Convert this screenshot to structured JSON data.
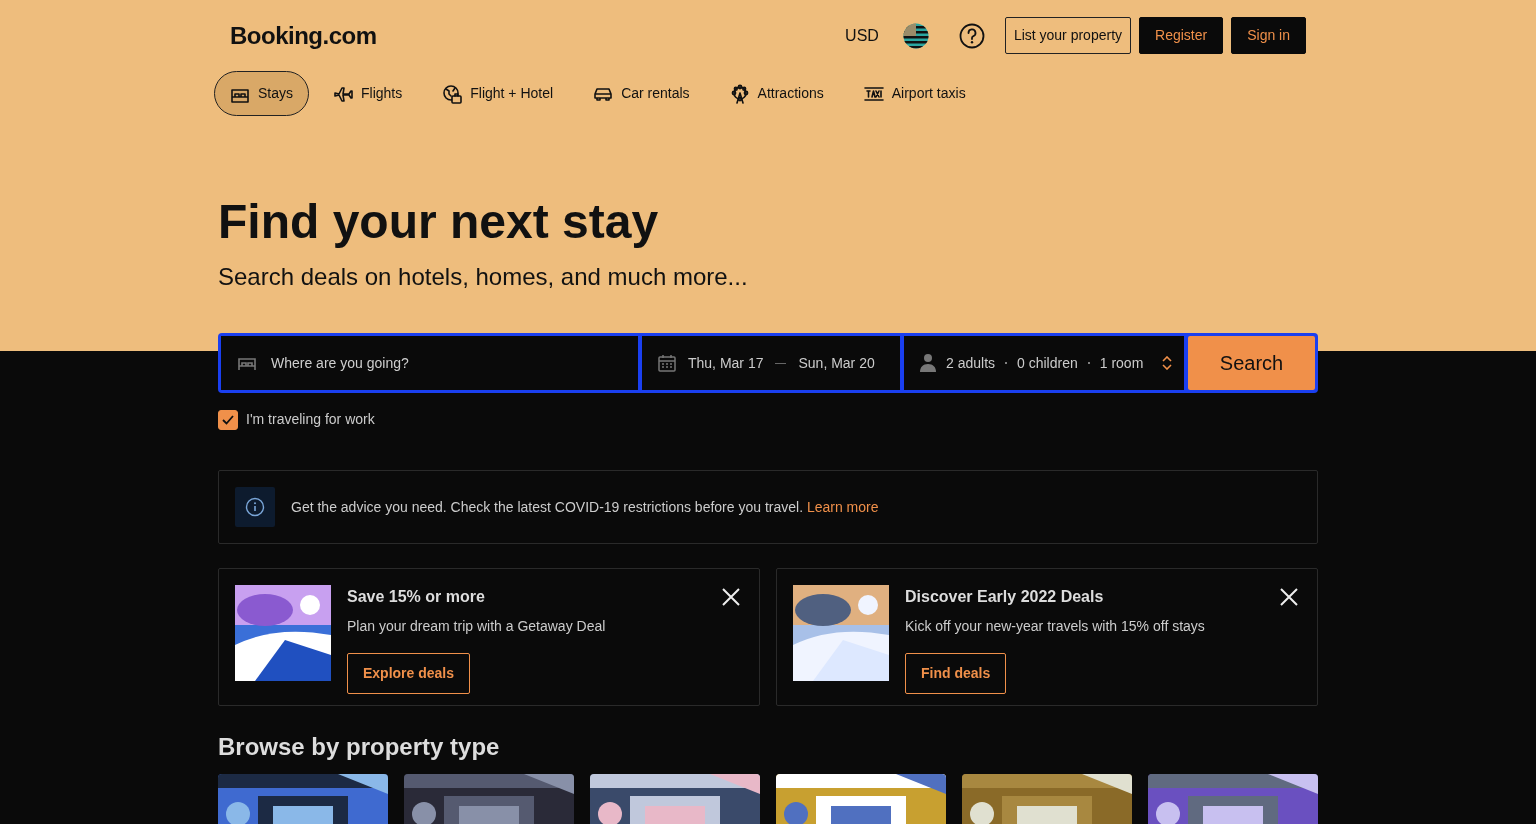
{
  "header": {
    "logo": "Booking.com",
    "currency": "USD",
    "buttons": [
      {
        "kind": "outline",
        "label": "List your property"
      },
      {
        "kind": "dark",
        "label": "Register"
      },
      {
        "kind": "dark",
        "label": "Sign in"
      }
    ]
  },
  "tabs": [
    {
      "kind": "bed",
      "label": "Stays",
      "selected": true
    },
    {
      "kind": "plane",
      "label": "Flights",
      "selected": false
    },
    {
      "kind": "globe",
      "label": "Flight + Hotel",
      "selected": false
    },
    {
      "kind": "car",
      "label": "Car rentals",
      "selected": false
    },
    {
      "kind": "wheel",
      "label": "Attractions",
      "selected": false
    },
    {
      "kind": "taxi",
      "label": "Airport taxis",
      "selected": false
    }
  ],
  "hero": {
    "title": "Find your next stay",
    "subtitle": "Search deals on hotels, homes, and much more..."
  },
  "search": {
    "destination": {
      "placeholder": "Where are you going?"
    },
    "check_in": "Thu, Mar 17",
    "check_out": "Sun, Mar 20",
    "adults": "2 adults",
    "children": "0 children",
    "rooms": "1 room",
    "button": "Search"
  },
  "work_travel": {
    "label": "I'm traveling for work",
    "checked": true
  },
  "notice": {
    "text": "Get the advice you need. Check the latest COVID-19 restrictions before you travel.",
    "link": "Learn more"
  },
  "promos": [
    {
      "title": "Save 15% or more",
      "text": "Plan your dream trip with a Getaway Deal",
      "button": "Explore deals"
    },
    {
      "title": "Discover Early 2022 Deals",
      "text": "Kick off your new-year travels with 15% off stays",
      "button": "Find deals"
    }
  ],
  "property_types": {
    "heading": "Browse by property type"
  }
}
